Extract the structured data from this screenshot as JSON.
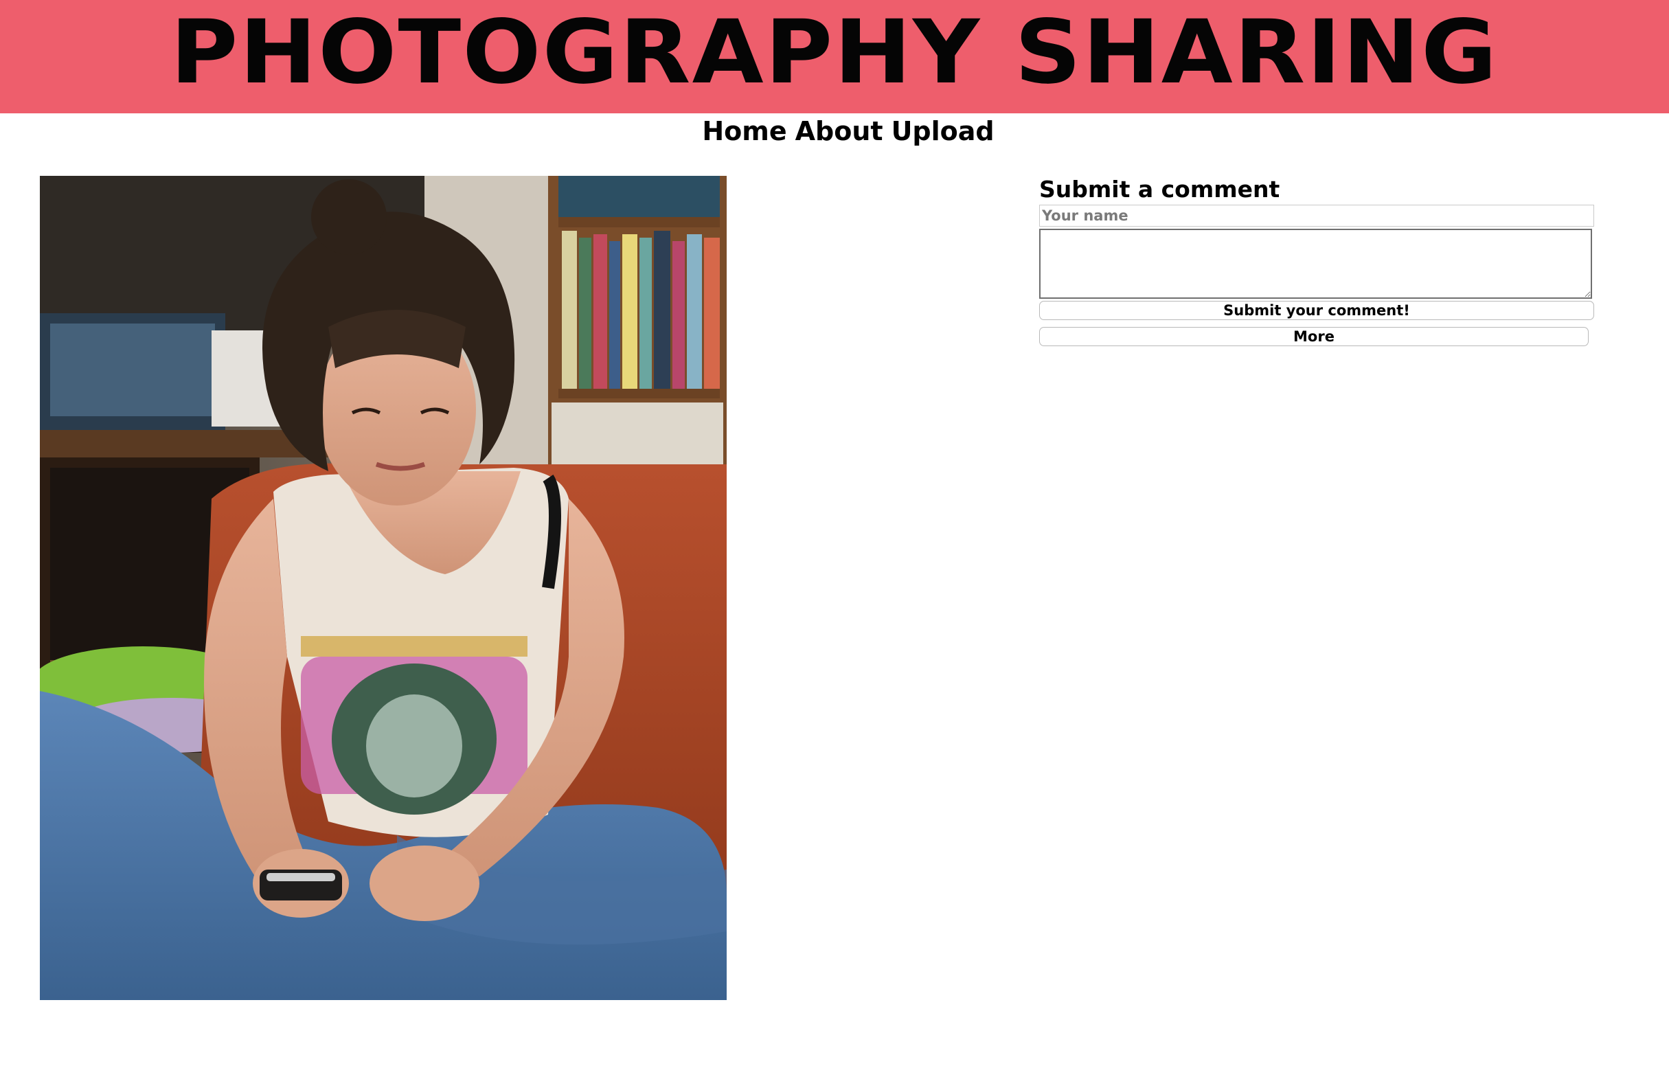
{
  "header": {
    "title": "PHOTOGRAPHY SHARING",
    "background_color": "#ee5e6c"
  },
  "nav": {
    "items": [
      {
        "label": "Home"
      },
      {
        "label": "About"
      },
      {
        "label": "Upload"
      }
    ]
  },
  "photo": {
    "subject": "woman-with-phone-photo"
  },
  "comment_form": {
    "heading": "Submit a comment",
    "name_placeholder": "Your name",
    "name_value": "",
    "comment_value": "",
    "submit_label": "Submit your comment!",
    "more_label": "More"
  }
}
